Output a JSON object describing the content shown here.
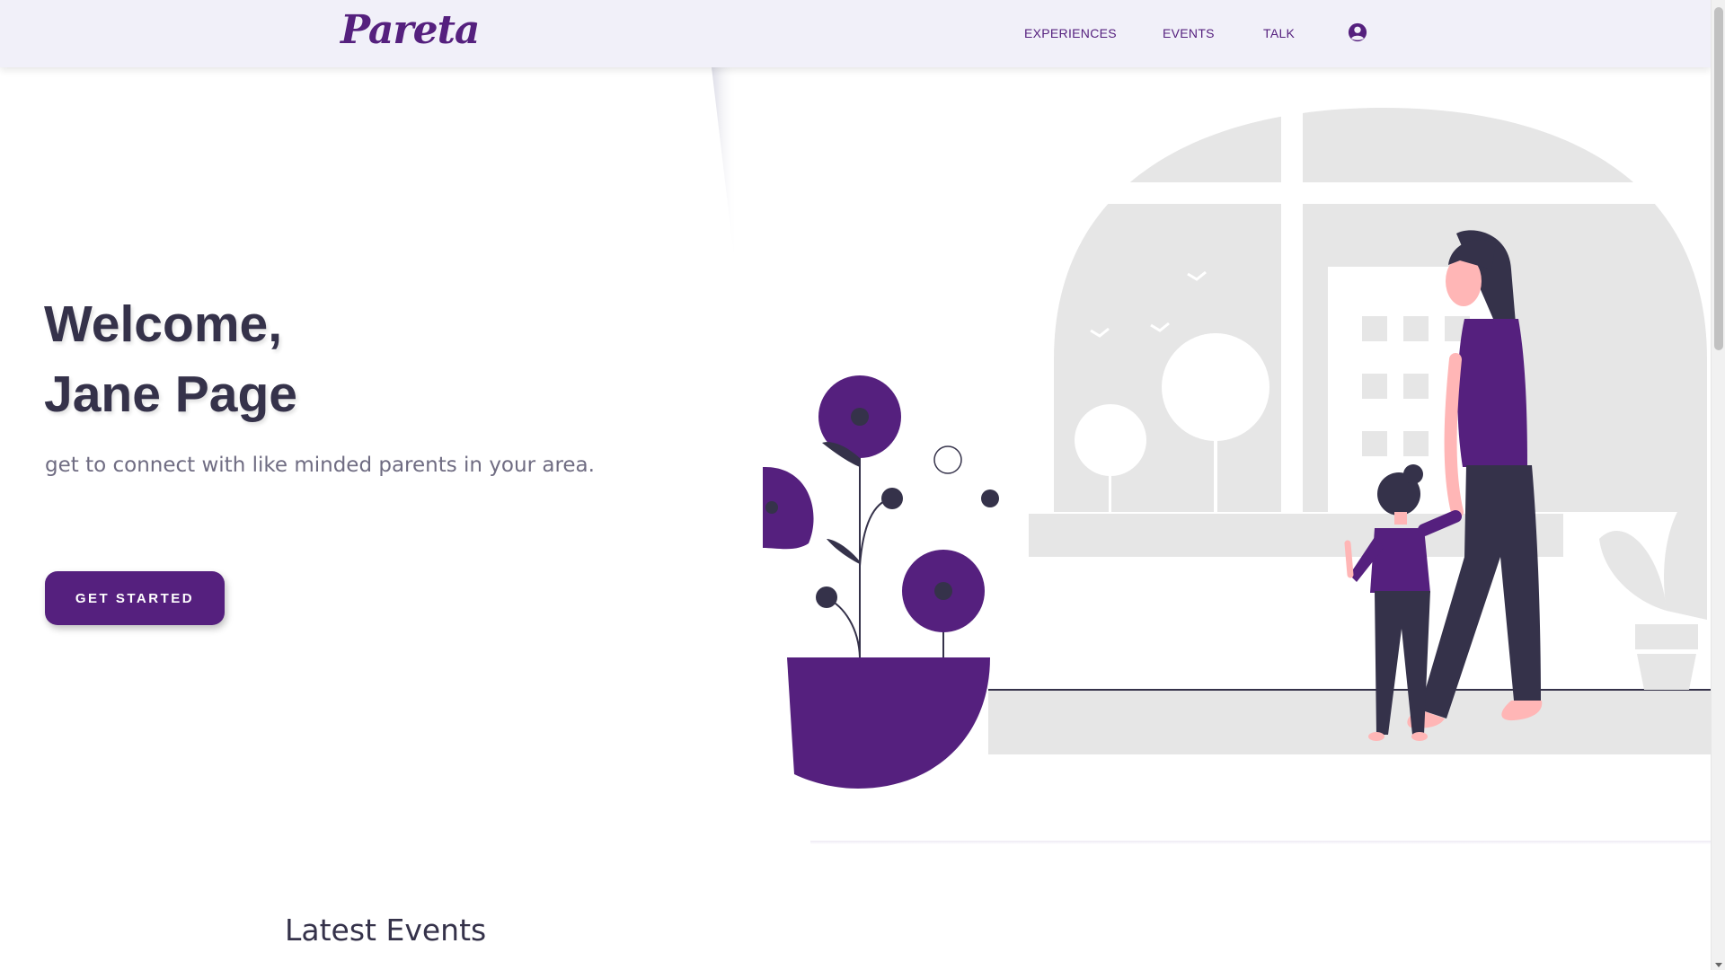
{
  "brand": {
    "logo": "Pareta",
    "accent_color": "#55207e"
  },
  "nav": {
    "items": [
      {
        "label": "EXPERIENCES"
      },
      {
        "label": "EVENTS"
      },
      {
        "label": "TALK"
      }
    ],
    "profile_icon": "user-circle-icon"
  },
  "hero": {
    "title_line1": "Welcome,",
    "title_line2": "Jane Page",
    "subtitle": "get to connect with like minded parents in your area.",
    "cta_label": "GET STARTED",
    "illustration": "mother-and-child-at-window-illustration"
  },
  "sections": {
    "latest_events_title": "Latest Events"
  },
  "colors": {
    "purple": "#55207e",
    "dark": "#35324a",
    "gray_light": "#e6e6e6",
    "skin": "#ffb6b6"
  }
}
